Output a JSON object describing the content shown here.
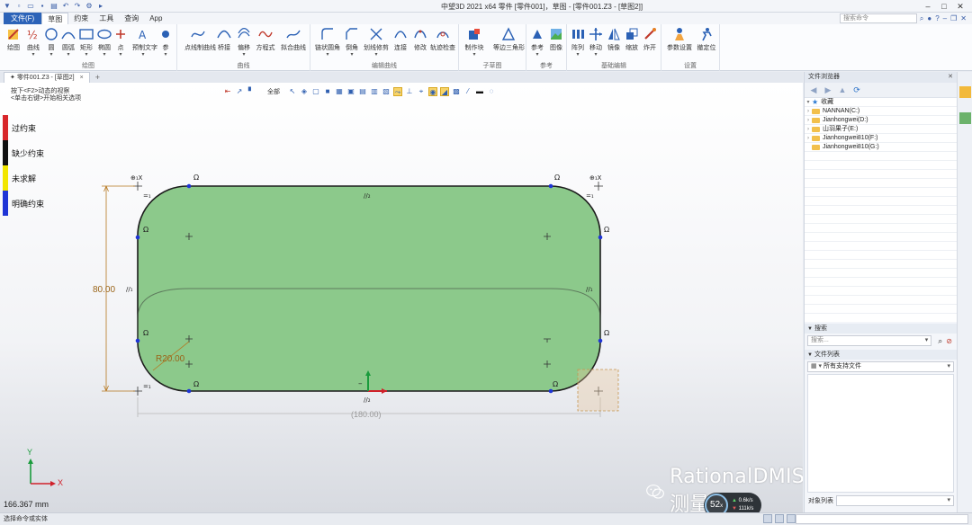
{
  "title_bar": {
    "title": "中望3D 2021 x64     零件 [零件001]，草图 - [零件001.Z3 - [草图2]]"
  },
  "menu": {
    "file": "文件(F)",
    "tabs": [
      "草图",
      "约束",
      "工具",
      "查询",
      "App"
    ],
    "active_tab": "草图",
    "search_placeholder": "搜索命令"
  },
  "ribbon": {
    "groups": [
      {
        "title": "绘图",
        "buttons": [
          "绘图",
          "曲线",
          "圆",
          "圆弧",
          "矩形",
          "椭圆",
          "点",
          "预制文字",
          "参"
        ]
      },
      {
        "title": "曲线",
        "buttons": [
          "点线制曲线",
          "桥接",
          "偏移",
          "方程式",
          "拟合曲线"
        ]
      },
      {
        "title": "编辑曲线",
        "buttons": [
          "链状圆角",
          "倒角",
          "划线修剪",
          "连接",
          "修改",
          "轨迹检查"
        ]
      },
      {
        "title": "子草图",
        "buttons": [
          "制作块",
          "等边三角形"
        ]
      },
      {
        "title": "参考",
        "buttons": [
          "参考",
          "图像"
        ]
      },
      {
        "title": "基础编辑",
        "buttons": [
          "阵列",
          "移动",
          "镜像",
          "缩放",
          "炸开"
        ]
      },
      {
        "title": "设置",
        "buttons": [
          "参数设置",
          "撤定位"
        ]
      }
    ]
  },
  "document_tabs": [
    {
      "label": "零件001.Z3 - [草图2]",
      "close": "×"
    }
  ],
  "viewport": {
    "hint_line1": "按下<F2>动态的视察",
    "hint_line2": "<单击右键>开始相关选项",
    "filter_label": "全部",
    "coordinate_readout": "166.367 mm",
    "dimensions": {
      "height": "80.00",
      "radius": "R20.00",
      "width": "(180.00)"
    },
    "constraint_symbols": {
      "parallel": "//₂",
      "parallel_side": "//₁",
      "equal": "=₁"
    },
    "axis_labels": {
      "x": "X",
      "y": "Y"
    }
  },
  "legend": [
    {
      "label": "过约束",
      "color": "#d8262a"
    },
    {
      "label": "缺少约束",
      "color": "#111111"
    },
    {
      "label": "未求解",
      "color": "#f2e600"
    },
    {
      "label": "明确约束",
      "color": "#1f35d6"
    }
  ],
  "watermark": {
    "text": "RationalDMIS测量技术"
  },
  "performance": {
    "fps": "52",
    "fps_unit": "x",
    "upload": "0.6",
    "upload_unit": "k/s",
    "download": "111",
    "download_unit": "k/s"
  },
  "file_browser": {
    "title": "文件浏览器",
    "tree": [
      {
        "label": "收藏",
        "type": "star"
      },
      {
        "label": "NANNAN(C:)",
        "type": "drive"
      },
      {
        "label": "Jianhongwei(D:)",
        "type": "drive"
      },
      {
        "label": "山羽果子(E:)",
        "type": "drive"
      },
      {
        "label": "Jianhongwei810(F:)",
        "type": "drive"
      },
      {
        "label": "Jianhongwei810(G:)",
        "type": "drive"
      }
    ],
    "search_title": "搜索",
    "search_placeholder": "搜索...",
    "file_list_title": "文件列表",
    "filter_value": "所有支持文件",
    "object_list_label": "对象列表"
  },
  "status_bar": {
    "text": "选择命令或实体"
  },
  "colors": {
    "sketch_fill": "#8cc98b",
    "sketch_line": "#1c1c1c",
    "point_blue": "#1f35d6",
    "dimension": "#b5761e",
    "file_tab": "#2c63b8"
  }
}
